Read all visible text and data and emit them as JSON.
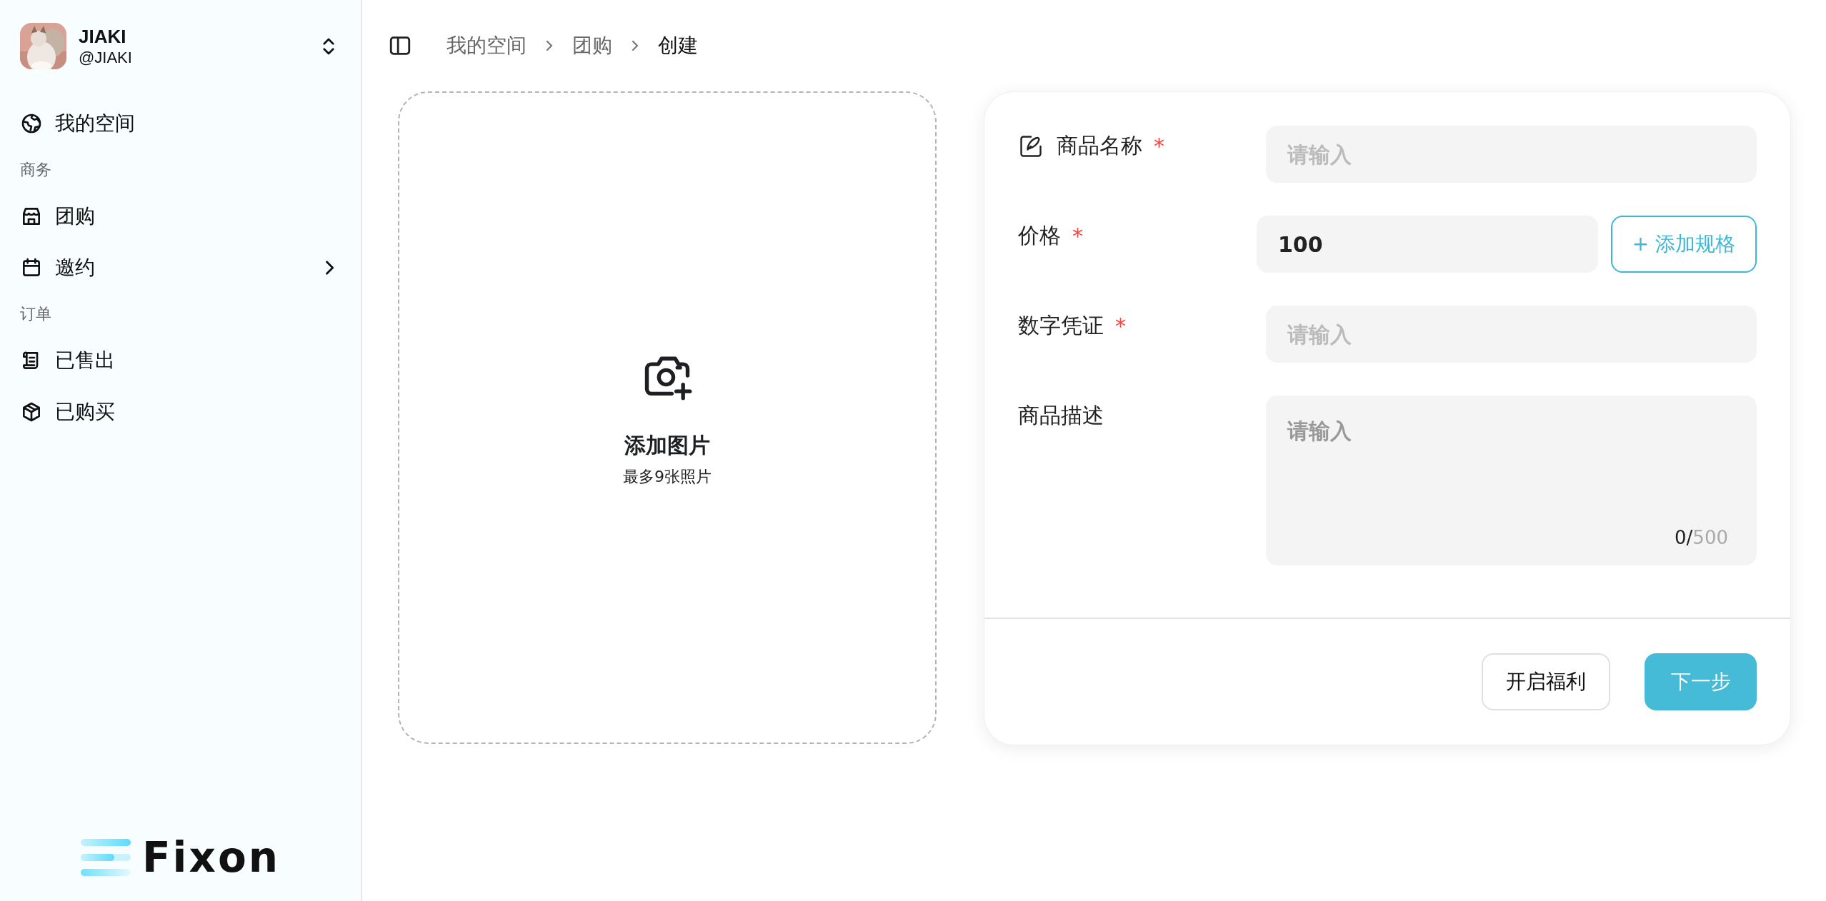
{
  "user": {
    "name": "JIAKI",
    "handle": "@JIAKI"
  },
  "nav": [
    {
      "kind": "item",
      "label": "我的空间",
      "submenu": false
    },
    {
      "kind": "section",
      "label": "商务"
    },
    {
      "kind": "item",
      "label": "团购",
      "submenu": false
    },
    {
      "kind": "item",
      "label": "邀约",
      "submenu": true
    },
    {
      "kind": "section",
      "label": "订单"
    },
    {
      "kind": "item",
      "label": "已售出",
      "submenu": false
    },
    {
      "kind": "item",
      "label": "已购买",
      "submenu": false
    }
  ],
  "logo": {
    "text": "Fixon"
  },
  "breadcrumbs": [
    {
      "label": "我的空间",
      "selected": false
    },
    {
      "label": "团购",
      "selected": false
    },
    {
      "label": "创建",
      "selected": true
    }
  ],
  "upload": {
    "title": "添加图片",
    "hint": "最多9张照片"
  },
  "form": {
    "fields": [
      {
        "kind": "text",
        "label": "商品名称",
        "required": "*",
        "placeholder": "请输入"
      },
      {
        "kind": "price",
        "label": "价格",
        "required": "*",
        "value": "100",
        "action": "+ 添加规格"
      },
      {
        "kind": "text",
        "label": "数字凭证",
        "required": "*",
        "placeholder": "请输入"
      },
      {
        "kind": "textarea",
        "label": "商品描述",
        "placeholder": "请输入",
        "count": "0/",
        "limit": "500"
      }
    ],
    "buttons": [
      {
        "kind": "outline",
        "label": "开启福利"
      },
      {
        "kind": "primary",
        "label": "下一步"
      }
    ]
  }
}
